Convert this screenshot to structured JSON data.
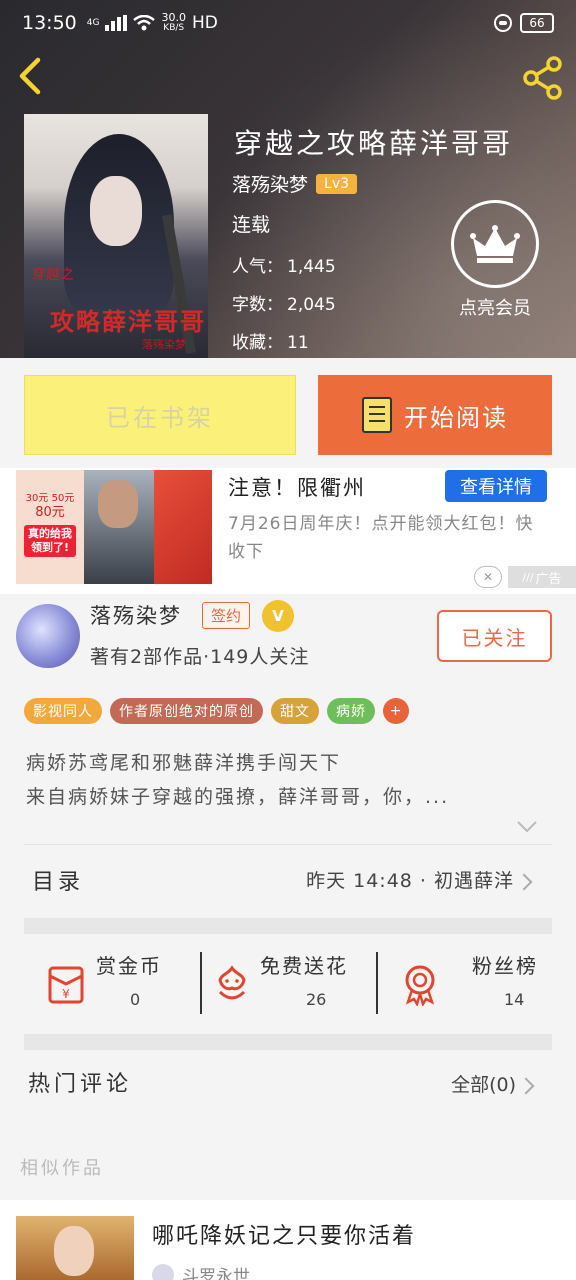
{
  "status_bar": {
    "time": "13:50",
    "signal_label": "4G",
    "speed_value": "30.0",
    "speed_unit": "KB/S",
    "hd": "HD",
    "battery": "66"
  },
  "header": {
    "back_icon": "chevron-left-icon",
    "share_icon": "share-icon"
  },
  "book": {
    "cover_line1": "穿越之",
    "cover_line2": "攻略薛洋哥哥",
    "cover_line3": "落殇染梦",
    "title": "穿越之攻略薛洋哥哥",
    "author": "落殇染梦",
    "author_level": "Lv3",
    "status": "连载",
    "stats": [
      {
        "label": "人气：",
        "value": "1,445"
      },
      {
        "label": "字数：",
        "value": "2,045"
      },
      {
        "label": "收藏：",
        "value": "11"
      }
    ],
    "vip_label": "点亮会员"
  },
  "actions": {
    "shelf_label": "已在书架",
    "read_label": "开始阅读"
  },
  "ad": {
    "coupon_small1": "30元",
    "coupon_small2": "50元",
    "coupon_big": "80元",
    "coupon_cta": "真的给我领到了!",
    "title": "注意！限衢州",
    "button": "查看详情",
    "desc": "7月26日周年庆！点开能领大红包！快收下",
    "close": "✕",
    "tag": "广告"
  },
  "author_card": {
    "name": "落殇染梦",
    "sign_badge": "签约",
    "v_badge": "V",
    "info": "著有2部作品·149人关注",
    "follow_label": "已关注"
  },
  "tags": [
    {
      "label": "影视同人",
      "color": "#f2a93b"
    },
    {
      "label": "作者原创绝对的原创",
      "color": "#c26a55"
    },
    {
      "label": "甜文",
      "color": "#d6a33a"
    },
    {
      "label": "病娇",
      "color": "#6dbf5a"
    },
    {
      "label": "+",
      "color": "#e8633a"
    }
  ],
  "intro": {
    "line1": "病娇苏鸢尾和邪魅薛洋携手闯天下",
    "line2": "来自病娇妹子穿越的强撩，薛洋哥哥，你，..."
  },
  "toc": {
    "label": "目录",
    "latest": "昨天 14:48 · 初遇薛洋"
  },
  "support": [
    {
      "label": "赏金币",
      "value": "0",
      "icon": "red-envelope-icon"
    },
    {
      "label": "免费送花",
      "value": "26",
      "icon": "flower-icon"
    },
    {
      "label": "粉丝榜",
      "value": "14",
      "icon": "medal-icon"
    }
  ],
  "comments": {
    "label": "热门评论",
    "all": "全部(0)"
  },
  "similar": {
    "heading": "相似作品",
    "item_title": "哪吒降妖记之只要你活着",
    "item_author": "斗罗永世"
  },
  "colors": {
    "accent": "#ec6c3c",
    "shelf": "#fbf17a",
    "ad_button": "#1e6fe8"
  }
}
